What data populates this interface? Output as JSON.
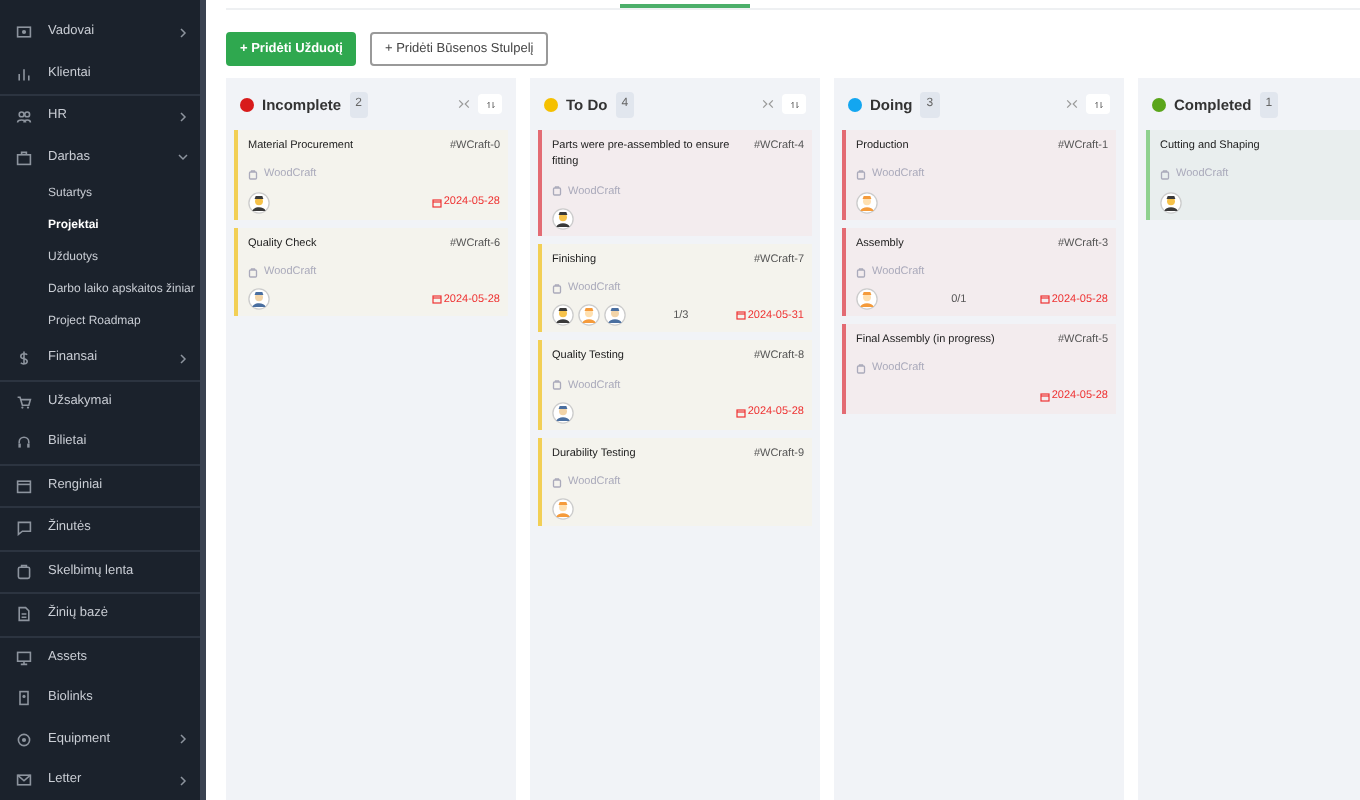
{
  "sidebar": {
    "items": [
      {
        "label": "Vadovai",
        "kind": "menu",
        "expanded": false,
        "selected": false
      },
      {
        "label": "Klientai",
        "kind": "link",
        "selected": false
      },
      {
        "label": "HR",
        "kind": "menu",
        "expanded": false,
        "selected": false
      },
      {
        "label": "Darbas",
        "kind": "menu",
        "expanded": true,
        "selected": false,
        "children": [
          {
            "label": "Sutartys",
            "selected": false
          },
          {
            "label": "Projektai",
            "selected": true
          },
          {
            "label": "Užduotys",
            "selected": false
          },
          {
            "label": "Darbo laiko apskaitos žiniar",
            "selected": false
          },
          {
            "label": "Project Roadmap",
            "selected": false
          }
        ]
      },
      {
        "label": "Finansai",
        "kind": "menu",
        "expanded": false,
        "selected": false
      },
      {
        "label": "Užsakymai",
        "kind": "link",
        "selected": false
      },
      {
        "label": "Bilietai",
        "kind": "link",
        "selected": false
      },
      {
        "label": "Renginiai",
        "kind": "link",
        "selected": false
      },
      {
        "label": "Žinutės",
        "kind": "link",
        "selected": false
      },
      {
        "label": "Skelbimų lenta",
        "kind": "link",
        "selected": false
      },
      {
        "label": "Žinių bazė",
        "kind": "link",
        "selected": false
      },
      {
        "label": "Assets",
        "kind": "link",
        "selected": false
      },
      {
        "label": "Biolinks",
        "kind": "link",
        "selected": false
      },
      {
        "label": "Equipment",
        "kind": "menu",
        "expanded": false,
        "selected": false
      },
      {
        "label": "Letter",
        "kind": "menu",
        "expanded": false,
        "selected": false
      }
    ]
  },
  "toolbar": {
    "buttons": [
      {
        "label": "+ Pridėti Užduotį",
        "kind": "primary"
      },
      {
        "label": "+ Pridėti Būsenos Stulpelį",
        "kind": "outline"
      }
    ]
  },
  "columns": [
    {
      "title": "Incomplete",
      "color": "#d81b1b",
      "count": "2",
      "cards": [
        {
          "title": "Material Procurement",
          "id": "#WCraft-0",
          "project": "WoodCraft",
          "color": "#f2cf55",
          "avatars": [
            {
              "kind": "dark"
            }
          ],
          "due": "2024-05-28"
        },
        {
          "title": "Quality Check",
          "id": "#WCraft-6",
          "project": "WoodCraft",
          "color": "#f2cf55",
          "avatars": [
            {
              "kind": "blue"
            }
          ],
          "due": "2024-05-28"
        }
      ]
    },
    {
      "title": "To Do",
      "color": "#f5c000",
      "count": "4",
      "cards": [
        {
          "title": "Parts were pre-assembled to ensure fitting",
          "id": "#WCraft-4",
          "project": "WoodCraft",
          "color": "#e36b73",
          "avatars": [
            {
              "kind": "dark"
            }
          ]
        },
        {
          "title": "Finishing",
          "id": "#WCraft-7",
          "project": "WoodCraft",
          "color": "#f2cf55",
          "avatars": [
            {
              "kind": "dark"
            },
            {
              "kind": "orange"
            },
            {
              "kind": "blue"
            }
          ],
          "progress": "1/3",
          "due": "2024-05-31"
        },
        {
          "title": "Quality Testing",
          "id": "#WCraft-8",
          "project": "WoodCraft",
          "color": "#f2cf55",
          "avatars": [
            {
              "kind": "blue"
            }
          ],
          "due": "2024-05-28"
        },
        {
          "title": "Durability Testing",
          "id": "#WCraft-9",
          "project": "WoodCraft",
          "color": "#f2cf55",
          "avatars": [
            {
              "kind": "orange"
            }
          ]
        }
      ]
    },
    {
      "title": "Doing",
      "color": "#13a6f0",
      "count": "3",
      "cards": [
        {
          "title": "Production",
          "id": "#WCraft-1",
          "project": "WoodCraft",
          "color": "#e36b73",
          "avatars": [
            {
              "kind": "orange"
            }
          ]
        },
        {
          "title": "Assembly",
          "id": "#WCraft-3",
          "project": "WoodCraft",
          "color": "#e36b73",
          "avatars": [
            {
              "kind": "orange"
            }
          ],
          "progress": "0/1",
          "due": "2024-05-28"
        },
        {
          "title": "Final Assembly (in progress)",
          "id": "#WCraft-5",
          "project": "WoodCraft",
          "color": "#e36b73",
          "due": "2024-05-28"
        }
      ]
    },
    {
      "title": "Completed",
      "color": "#5aa51a",
      "count": "1",
      "cards": [
        {
          "title": "Cutting and Shaping",
          "project": "WoodCraft",
          "color": "#8fd18f",
          "avatars": [
            {
              "kind": "dark"
            }
          ]
        }
      ]
    }
  ]
}
